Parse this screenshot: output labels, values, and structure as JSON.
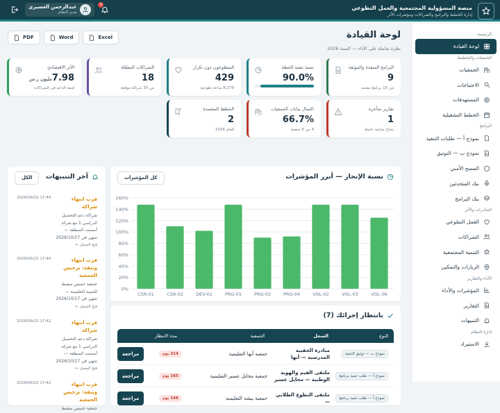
{
  "header": {
    "title": "منصة المسؤولية المجتمعية والعمل التطوعي",
    "subtitle": "إدارة الخطط والبرامج والشراكات ومؤشرات الأثر",
    "user_name": "عبدالرحمن العسيري",
    "user_role": "مدير النظام",
    "notif_count": "4"
  },
  "sidebar": {
    "sections": [
      {
        "title": "الرئيسية",
        "items": [
          {
            "label": "لوحة القيادة",
            "icon": "grid-icon",
            "active": true
          }
        ]
      },
      {
        "title": "الجمعيات والتخطيط",
        "items": [
          {
            "label": "الجمعيات",
            "icon": "building-icon"
          },
          {
            "label": "الاحتياجات",
            "icon": "search-icon"
          },
          {
            "label": "المستهدفات",
            "icon": "target-icon"
          },
          {
            "label": "الخطط التشغيلية",
            "icon": "calendar-icon"
          }
        ]
      },
      {
        "title": "البرامج",
        "items": [
          {
            "label": "نموذج أ — طلبات التنفيذ",
            "icon": "file-icon"
          },
          {
            "label": "نموذج ب — التوثيق",
            "icon": "check-file-icon"
          },
          {
            "label": "المسح الأمني",
            "icon": "shield-icon"
          },
          {
            "label": "بنك المتحدثين",
            "icon": "mic-icon"
          },
          {
            "label": "بنك البرامج",
            "icon": "layers-icon"
          }
        ]
      },
      {
        "title": "المبادرات والأثر",
        "items": [
          {
            "label": "العمل التطوعي",
            "icon": "heart-icon"
          },
          {
            "label": "الشراكات",
            "icon": "users-icon"
          },
          {
            "label": "التنمية المجتمعية",
            "icon": "star-icon"
          },
          {
            "label": "الزيارات والتمكين",
            "icon": "pin-icon"
          }
        ]
      },
      {
        "title": "الأداء والتقارير",
        "items": [
          {
            "label": "المؤشرات والأداء",
            "icon": "chart-icon"
          },
          {
            "label": "التقارير",
            "icon": "report-icon"
          },
          {
            "label": "التنبيهات",
            "icon": "bell-icon"
          }
        ]
      },
      {
        "title": "إدارة النظام",
        "items": [
          {
            "label": "الاستيراد",
            "icon": "import-icon"
          }
        ]
      }
    ]
  },
  "page": {
    "title": "لوحة القيادة",
    "subtitle": "نظرة شاملة على الأداء — السنة 2026",
    "export": [
      "Excel",
      "Word",
      "PDF"
    ]
  },
  "kpis_row1": [
    {
      "label": "البرامج المنفذة والموثقة",
      "value": "9",
      "note": "من 10 برنامج معتمد",
      "color": "#2e7d4f",
      "icon": "doc-icon"
    },
    {
      "label": "نسبة تنفيذ الخطة",
      "value": "90.0%",
      "note": "",
      "progress": 0.9,
      "color": "#1f7f86",
      "icon": "pie-icon"
    },
    {
      "label": "المتطوعون دون تكرار",
      "value": "429",
      "note": "8,279 ساعة تطوعية",
      "color": "#1f7f86",
      "icon": "heart-icon"
    },
    {
      "label": "الشراكات المفعّلة",
      "value": "18",
      "note": "من 30 شراكة موقعة",
      "color": "#6b4fa3",
      "icon": "users-icon"
    },
    {
      "label": "الأثر الاقتصادي",
      "value": "7.98",
      "unit": "مليون ر.س",
      "note": "قيمة الدعم في الشراكات",
      "color": "#2e9e5a",
      "icon": "coin-icon"
    }
  ],
  "kpis_row2": [
    {
      "label": "تقارير متأخرة",
      "value": "1",
      "note": "تحتاج متابعة عاجلة",
      "color": "#c0392b",
      "icon": "warning-icon"
    },
    {
      "label": "اكتمال بيانات الجمعيات",
      "value": "66.7%",
      "note": "4 من 6 جمعية",
      "color": "#c0392b",
      "icon": "building-icon"
    },
    {
      "label": "الخطط المعتمدة",
      "value": "2",
      "note": "للعام 2026",
      "color": "#164551",
      "icon": "book-icon"
    }
  ],
  "chart": {
    "title": "نسبة الإنجاز — أبرز المؤشرات",
    "link": "كل المؤشرات"
  },
  "chart_data": {
    "type": "bar",
    "categories": [
      "CSR-01",
      "CSR-02",
      "DEV-01",
      "PRG-01",
      "PRG-02",
      "PRG-04",
      "VOL-02",
      "VOL-03",
      "VOL-06"
    ],
    "values": [
      148,
      110,
      102,
      148,
      90,
      92,
      148,
      148,
      125
    ],
    "ylim": [
      0,
      160
    ],
    "yticks": [
      "0%",
      "20%",
      "40%",
      "60%",
      "80%",
      "100%",
      "120%",
      "140%",
      "160%"
    ],
    "color": "#4cb86a"
  },
  "notifications": {
    "title": "آخر التنبيهات",
    "link": "الكل",
    "items": [
      {
        "date": "2026/09/22 17:44",
        "title": "قرب انتهاء شراكة",
        "body": "شراكة دعم التحصيل الدراسي 1 مع شركة أسمنت المنطقة — تنتهي في 2026/10/17",
        "foot": "فتح السجل ←"
      },
      {
        "date": "2026/09/22 17:44",
        "title": "قرب انتهاء وثيقة: ترخيص الجمعية",
        "body": "جمعية خميس مشيط للتنمية التعليمية — تنتهي في 2026/10/17",
        "foot": "فتح السجل ←"
      },
      {
        "date": "2026/09/22 17:42",
        "title": "قرب انتهاء شراكة",
        "body": "شراكة دعم التحصيل الدراسي 1 مع شركة أسمنت المنطقة — تنتهي في 2026/10/17",
        "foot": "فتح السجل ←"
      },
      {
        "date": "2026/09/22 17:42",
        "title": "قرب انتهاء وثيقة: ترخيص الجمعية",
        "body": "جمعية خميس مشيط",
        "foot": ""
      }
    ]
  },
  "pending": {
    "title": "بانتظار إجرائك (7)",
    "headers": [
      "النوع",
      "السجل",
      "الجمعية",
      "مدة الانتظار",
      ""
    ],
    "rows": [
      {
        "type": "نموذج ب — توثيق التنفيذ",
        "record": "مبادرة الحقيبة المدرسية — أبها",
        "assoc": "جمعية أبها التعليمية",
        "wait": "214 يوم",
        "action": "مراجعة"
      },
      {
        "type": "نموذج أ — طلب تنفيذ برنامج",
        "record": "ملتقى القيم والهوية الوطنية — محايل عسير",
        "assoc": "جمعية محايل عسير التعليمية",
        "wait": "165 يوم",
        "action": "مراجعة"
      },
      {
        "type": "نموذج أ — طلب تنفيذ برنامج",
        "record": "ملتقى التطوع الطلابي —",
        "assoc": "جمعية بيشة التعليمية",
        "wait": "148 يوم",
        "action": "مراجعة"
      }
    ]
  }
}
